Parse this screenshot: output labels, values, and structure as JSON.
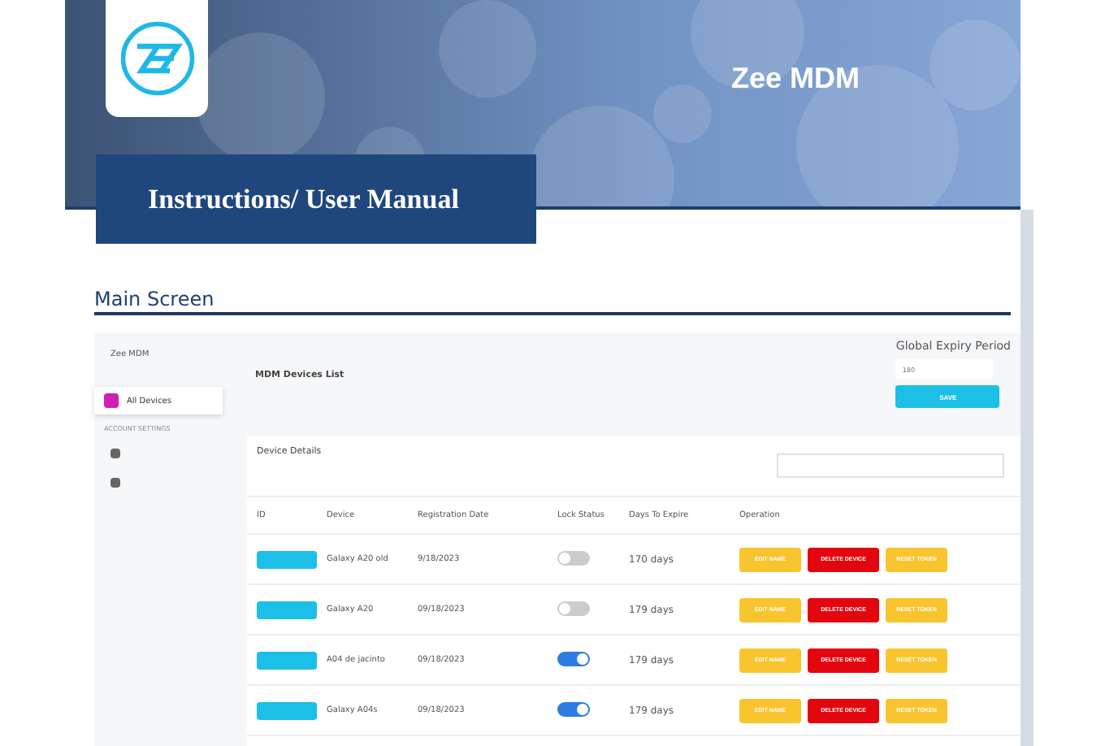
{
  "header": {
    "product": "Zee MDM",
    "manual_title": "Instructions/ User Manual"
  },
  "section_title": "Main Screen",
  "app": {
    "brand": "Zee MDM",
    "sidebar": {
      "items": [
        {
          "label": "All Devices",
          "selected": true
        }
      ],
      "group_label": "ACCOUNT SETTINGS"
    },
    "page_title": "MDM Devices List",
    "expiry": {
      "label": "Global Expiry Period",
      "value": "180",
      "button": "SAVE"
    },
    "card_title": "Device Details",
    "columns": [
      "ID",
      "Device",
      "Registration Date",
      "Lock Status",
      "Days To Expire",
      "Operation"
    ],
    "rows": [
      {
        "device": "Galaxy A20 old",
        "date": "9/18/2023",
        "locked": false,
        "days": "170 days",
        "actions": [
          {
            "label": "EDIT NAME",
            "kind": "warn"
          },
          {
            "label": "DELETE DEVICE",
            "kind": "danger"
          },
          {
            "label": "RESET TOKEN",
            "kind": "warn"
          }
        ]
      },
      {
        "device": "Galaxy A20",
        "date": "09/18/2023",
        "locked": false,
        "days": "179 days",
        "actions": [
          {
            "label": "EDIT NAME",
            "kind": "warn"
          },
          {
            "label": "DELETE DEVICE",
            "kind": "danger"
          },
          {
            "label": "RESET TOKEN",
            "kind": "warn"
          }
        ]
      },
      {
        "device": "A04 de jacinto",
        "date": "09/18/2023",
        "locked": true,
        "days": "179 days",
        "actions": [
          {
            "label": "EDIT NAME",
            "kind": "warn"
          },
          {
            "label": "DELETE DEVICE",
            "kind": "danger"
          },
          {
            "label": "RESET TOKEN",
            "kind": "warn"
          }
        ]
      },
      {
        "device": "Galaxy A04s",
        "date": "09/18/2023",
        "locked": true,
        "days": "179 days",
        "actions": [
          {
            "label": "EDIT NAME",
            "kind": "warn"
          },
          {
            "label": "DELETE DEVICE",
            "kind": "danger"
          },
          {
            "label": "RESET TOKEN",
            "kind": "warn"
          }
        ]
      }
    ]
  }
}
